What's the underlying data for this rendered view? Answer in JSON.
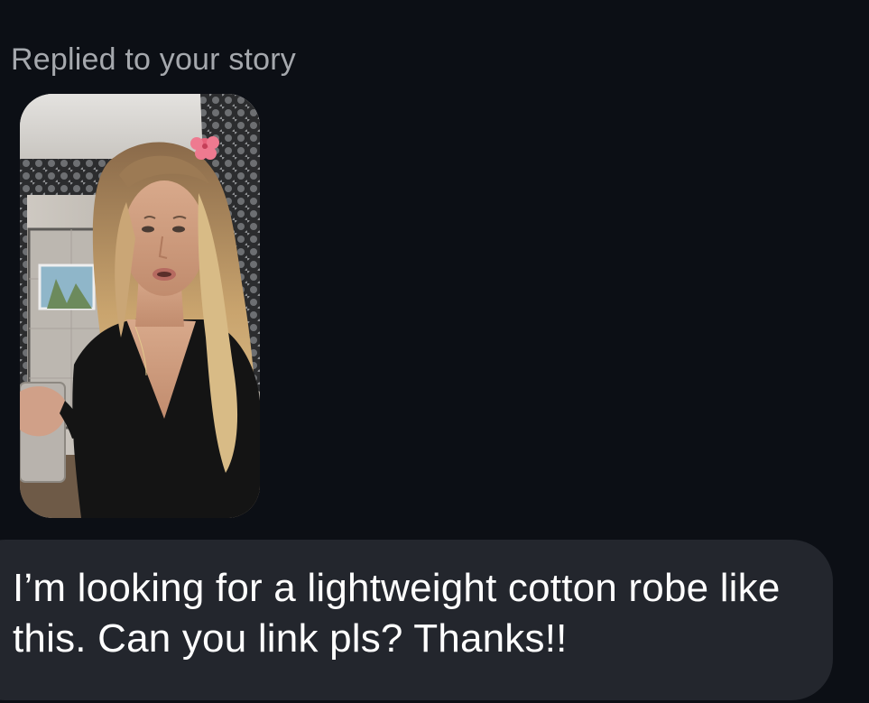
{
  "conversation": {
    "reply_context": "Replied to your story",
    "story_thumbnail": {
      "icon": "video-frame-image"
    },
    "message": {
      "text": "I’m looking for a lightweight cotton robe like this. Can you link pls? Thanks!!"
    }
  },
  "colors": {
    "background": "#0c0f15",
    "bubble": "#23262d",
    "label": "#a5a8ad",
    "text": "#ffffff"
  }
}
